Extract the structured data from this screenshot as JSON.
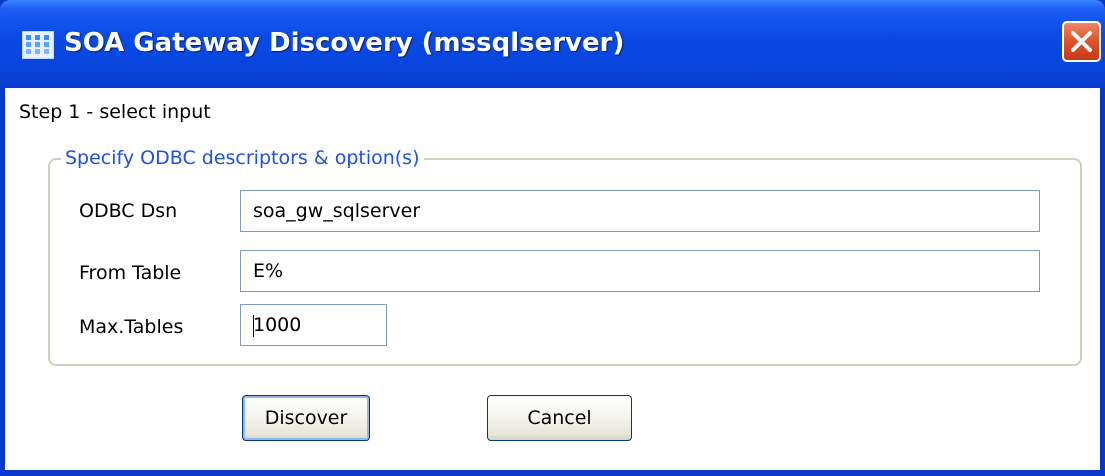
{
  "window": {
    "title": "SOA Gateway Discovery (mssqlserver)",
    "icon": "app-grid-icon",
    "close_icon": "close-x-icon"
  },
  "step_label": "Step 1 - select input",
  "group": {
    "legend": "Specify ODBC descriptors & option(s)",
    "fields": [
      {
        "label": "ODBC Dsn",
        "value": "soa_gw_sqlserver"
      },
      {
        "label": "From Table",
        "value": "E%"
      },
      {
        "label": "Max.Tables",
        "value": "1000"
      }
    ]
  },
  "buttons": {
    "discover": "Discover",
    "cancel": "Cancel"
  },
  "colors": {
    "titlebar": "#0a4ae6",
    "legend": "#1f50e0",
    "close": "#e0562c"
  }
}
